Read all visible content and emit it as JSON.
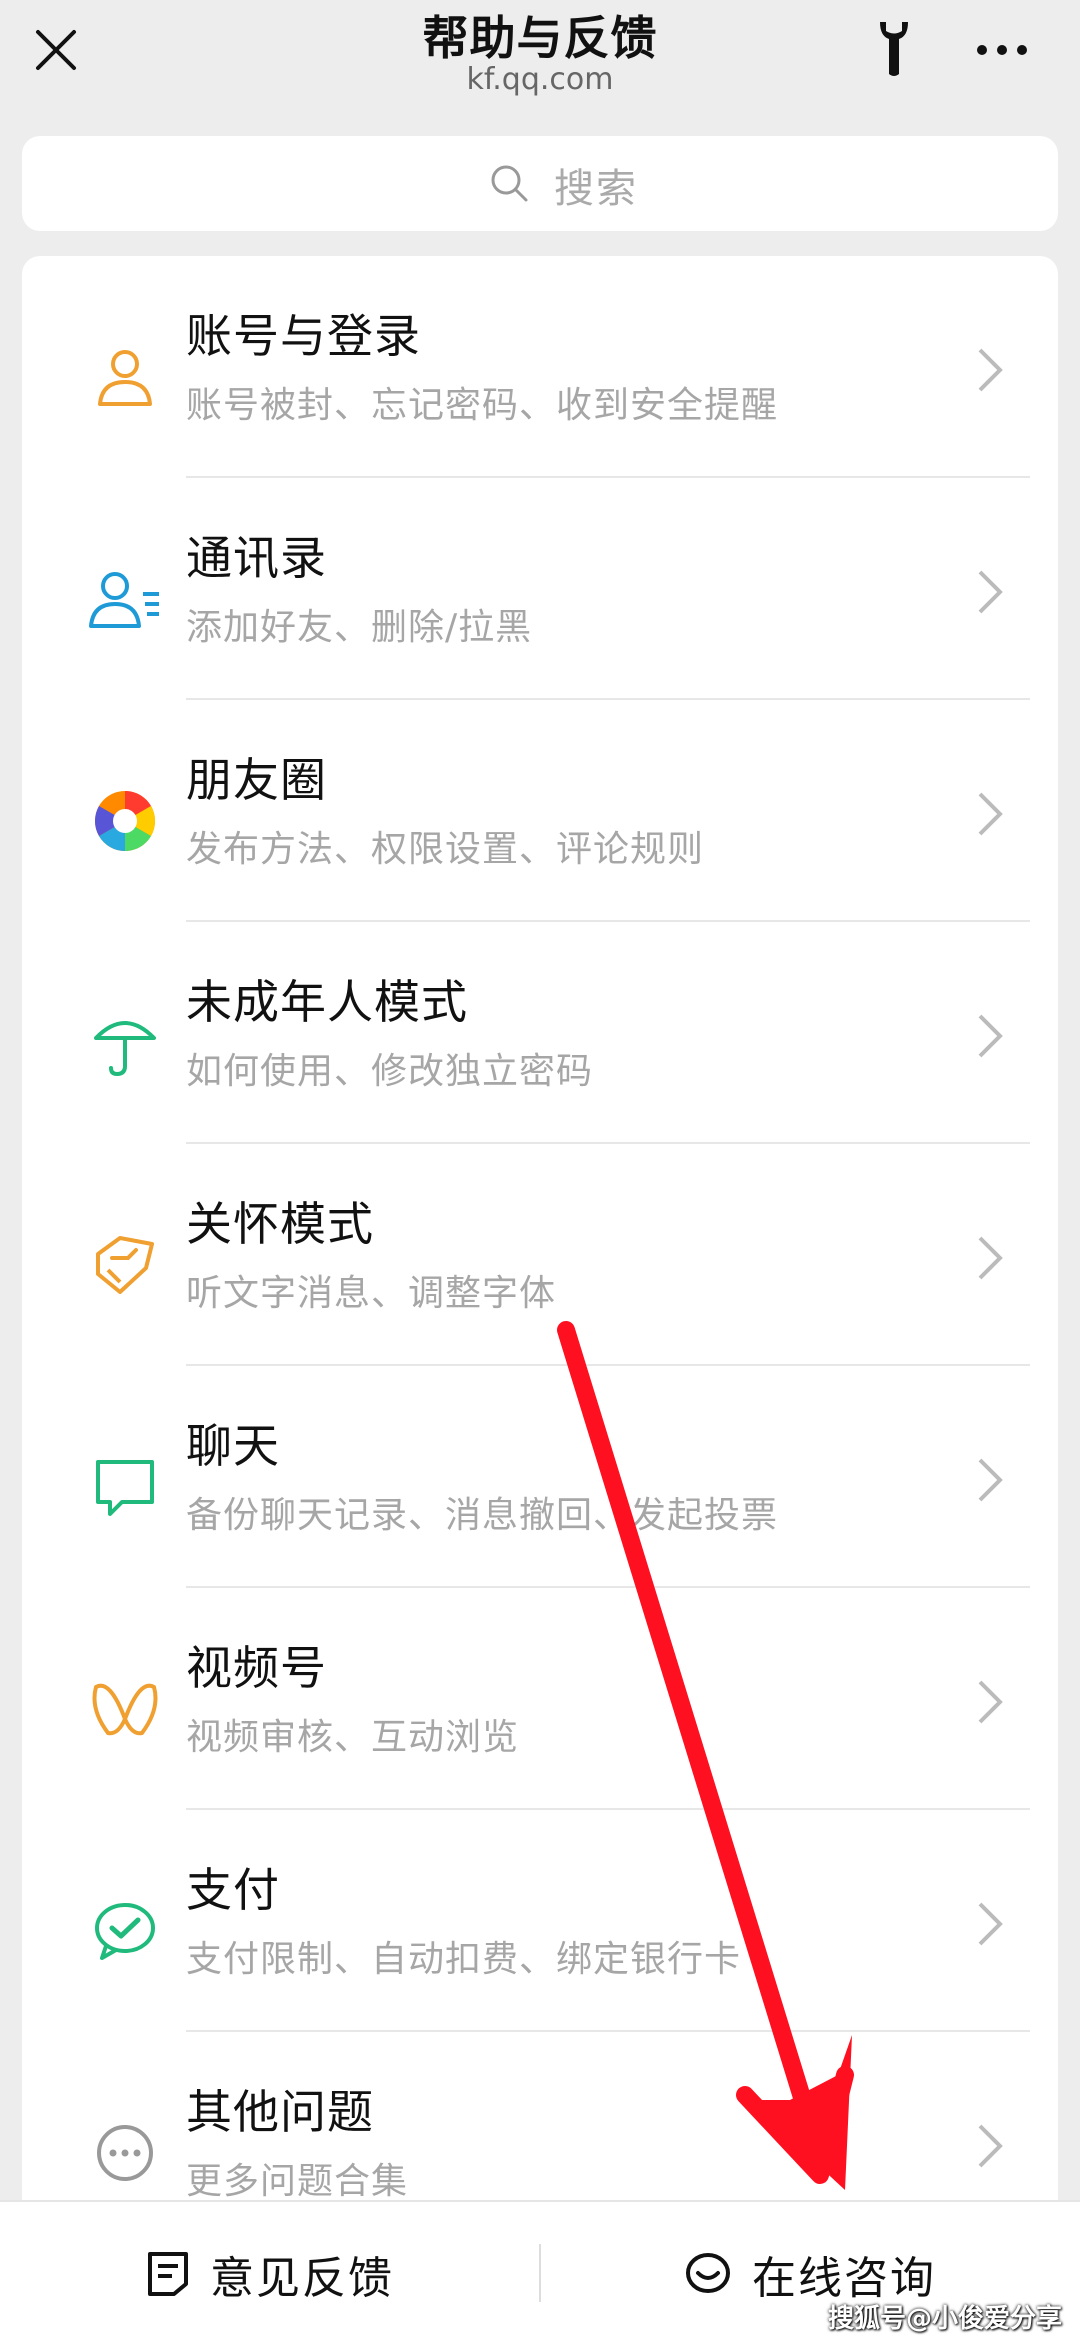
{
  "header": {
    "title": "帮助与反馈",
    "domain": "kf.qq.com",
    "close_icon": "close-icon",
    "tool_icon": "wrench-icon",
    "more_icon": "more-icon"
  },
  "search": {
    "placeholder": "搜索",
    "icon": "search-icon"
  },
  "categories": [
    {
      "title": "账号与登录",
      "desc": "账号被封、忘记密码、收到安全提醒",
      "icon": "person-icon",
      "color": "#f0a030"
    },
    {
      "title": "通讯录",
      "desc": "添加好友、删除/拉黑",
      "icon": "contacts-icon",
      "color": "#1e9bd7"
    },
    {
      "title": "朋友圈",
      "desc": "发布方法、权限设置、评论规则",
      "icon": "moments-icon",
      "color": "#ff8a00"
    },
    {
      "title": "未成年人模式",
      "desc": "如何使用、修改独立密码",
      "icon": "umbrella-icon",
      "color": "#1fba7c"
    },
    {
      "title": "关怀模式",
      "desc": "听文字消息、调整字体",
      "icon": "care-icon",
      "color": "#f0a030"
    },
    {
      "title": "聊天",
      "desc": "备份聊天记录、消息撤回、发起投票",
      "icon": "chat-icon",
      "color": "#1fba7c"
    },
    {
      "title": "视频号",
      "desc": "视频审核、互动浏览",
      "icon": "channels-icon",
      "color": "#f0a030"
    },
    {
      "title": "支付",
      "desc": "支付限制、自动扣费、绑定银行卡",
      "icon": "pay-icon",
      "color": "#1fba7c"
    },
    {
      "title": "其他问题",
      "desc": "更多问题合集",
      "icon": "more-circle-icon",
      "color": "#999999"
    }
  ],
  "footer": {
    "feedback_label": "意见反馈",
    "consult_label": "在线咨询",
    "feedback_icon": "note-icon",
    "consult_icon": "chat-bubble-icon"
  },
  "watermark": "搜狐号@小俊爱分享",
  "annotation": {
    "arrow_color": "#ff1020"
  }
}
